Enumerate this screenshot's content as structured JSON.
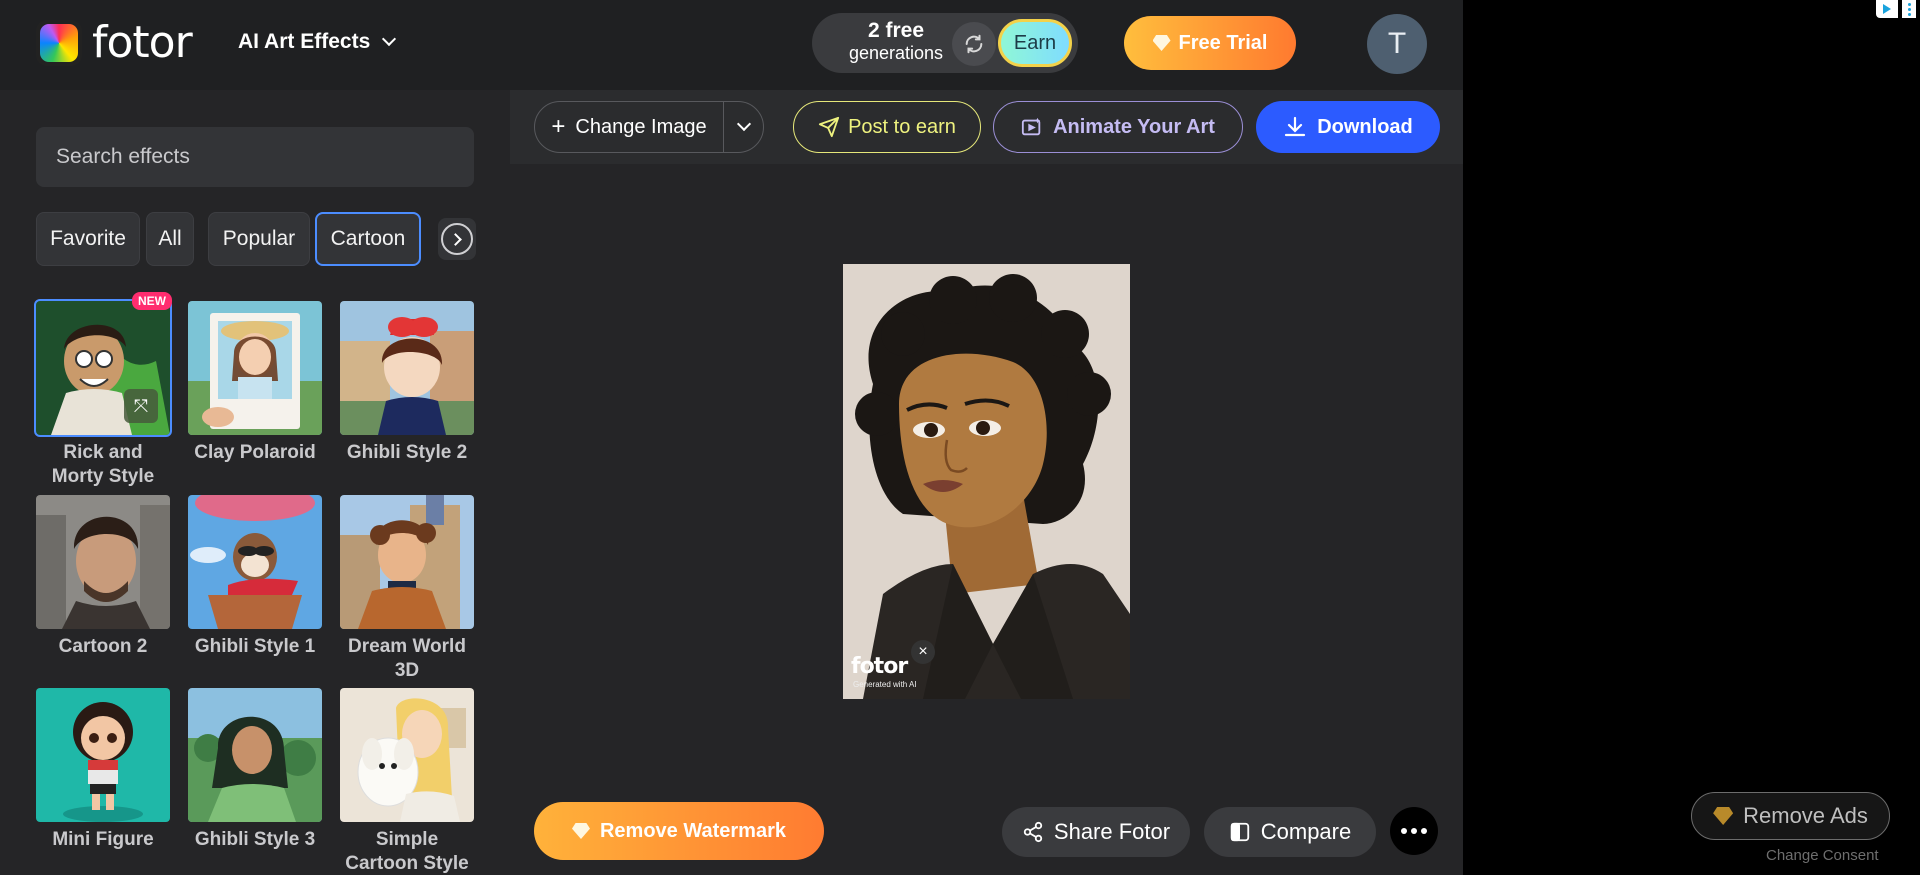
{
  "header": {
    "brand": "fotor",
    "nav_label": "AI Art Effects",
    "generations_count": "2 free",
    "generations_label": "generations",
    "earn_label": "Earn",
    "trial_label": "Free Trial",
    "avatar_initial": "T"
  },
  "sidebar": {
    "search_placeholder": "Search effects",
    "filters": [
      "Favorite",
      "All",
      "Popular",
      "Cartoon"
    ],
    "active_filter": "Cartoon",
    "effects": [
      {
        "label": "Rick and Morty Style",
        "badge": "NEW"
      },
      {
        "label": "Clay Polaroid"
      },
      {
        "label": "Ghibli Style 2"
      },
      {
        "label": "Cartoon 2"
      },
      {
        "label": "Ghibli Style 1"
      },
      {
        "label": "Dream World 3D"
      },
      {
        "label": "Mini Figure"
      },
      {
        "label": "Ghibli Style 3"
      },
      {
        "label": "Simple Cartoon Style"
      }
    ]
  },
  "toolbar": {
    "change_image_label": "Change Image",
    "post_label": "Post to earn",
    "animate_label": "Animate Your Art",
    "download_label": "Download"
  },
  "canvas": {
    "watermark_text": "fotor",
    "watermark_sub": "Generated with AI",
    "remove_watermark_label": "Remove Watermark",
    "share_label": "Share Fotor",
    "compare_label": "Compare"
  },
  "ads": {
    "remove_ads_label": "Remove Ads",
    "change_consent_label": "Change Consent"
  },
  "colors": {
    "accent_blue": "#2c5bff",
    "selection_blue": "#4c8dff",
    "orange_start": "#ffb23a",
    "orange_end": "#ff7b31",
    "panel_bg": "#252527"
  }
}
